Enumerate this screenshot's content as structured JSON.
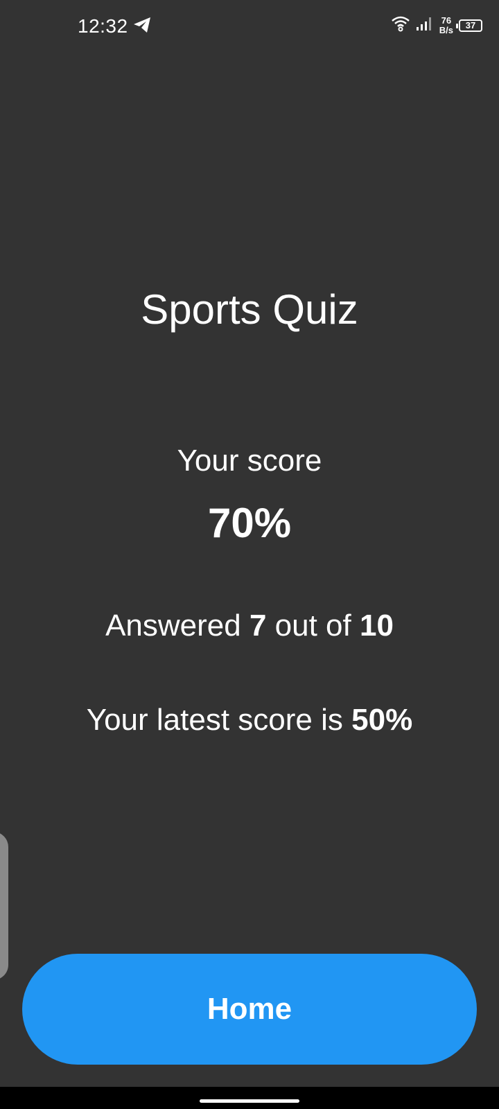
{
  "status_bar": {
    "time": "12:32",
    "net_speed_value": "76",
    "net_speed_unit": "B/s",
    "battery_level": "37",
    "icons": [
      "telegram-icon",
      "wifi-icon",
      "signal-icon",
      "battery-icon"
    ]
  },
  "quiz": {
    "title": "Sports Quiz",
    "score_label": "Your score",
    "score_value": "70%",
    "answered_prefix": "Answered ",
    "answered_count": "7",
    "answered_middle": " out of ",
    "answered_total": "10",
    "latest_prefix": "Your latest score is ",
    "latest_value": "50%"
  },
  "actions": {
    "home_label": "Home"
  },
  "colors": {
    "background": "#333333",
    "accent": "#2196f3",
    "text": "#ffffff"
  }
}
